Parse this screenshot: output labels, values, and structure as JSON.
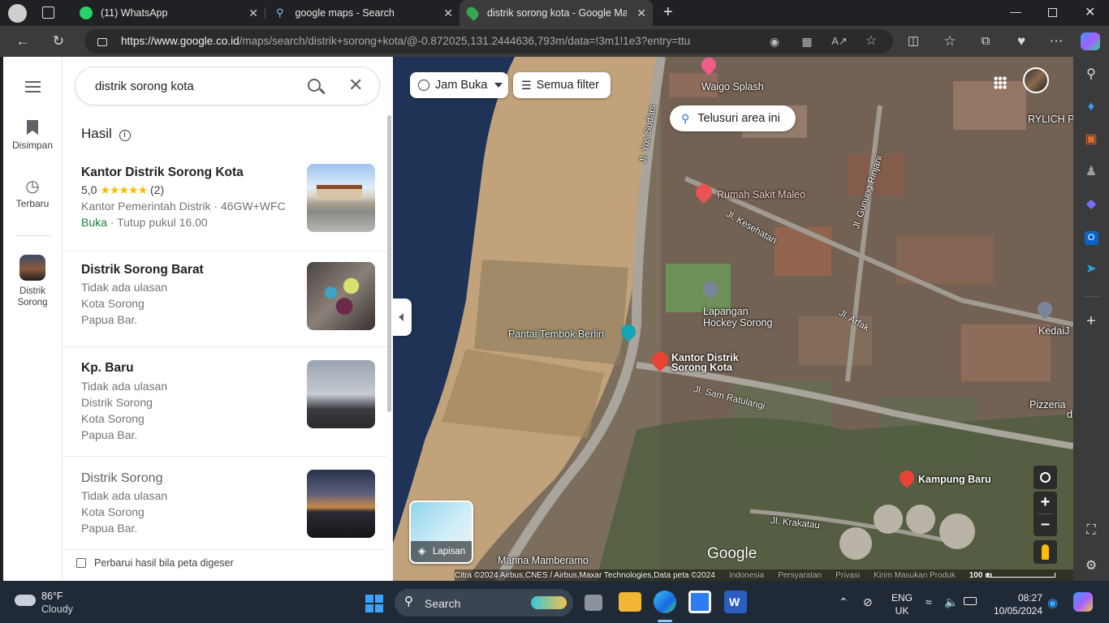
{
  "browser": {
    "tabs": [
      {
        "title": "(11) WhatsApp",
        "icon": "whatsapp-icon"
      },
      {
        "title": "google maps - Search",
        "icon": "search-icon"
      },
      {
        "title": "distrik sorong kota - Google Map",
        "icon": "google-maps-icon"
      }
    ],
    "url_domain": "https://www.google.co.id",
    "url_path": "/maps/search/distrik+sorong+kota/@-0.872025,131.2444636,793m/data=!3m1!1e3?entry=ttu"
  },
  "rail": {
    "menu_label": "",
    "saved_label": "Disimpan",
    "recent_label": "Terbaru",
    "recent_place_label": "Distrik Sorong"
  },
  "panel": {
    "search_value": "distrik sorong kota",
    "results_header": "Hasil",
    "results": [
      {
        "title": "Kantor Distrik Sorong Kota",
        "rating": "5,0",
        "stars": "★★★★★",
        "reviews": "(2)",
        "category": "Kantor Pemerintah Distrik · 46GW+WFC",
        "open": "Buka",
        "hours": " · Tutup pukul 16.00"
      },
      {
        "title": "Distrik Sorong Barat",
        "line1": "Tidak ada ulasan",
        "line2": "Kota Sorong",
        "line3": "Papua Bar."
      },
      {
        "title": "Kp. Baru",
        "line1": "Tidak ada ulasan",
        "line2": "Distrik Sorong",
        "line3": "Kota Sorong",
        "line4": "Papua Bar."
      },
      {
        "title": "Distrik Sorong",
        "line1": "Tidak ada ulasan",
        "line2": "Kota Sorong",
        "line3": "Papua Bar."
      }
    ],
    "update_checkbox": "Perbarui hasil bila peta digeser"
  },
  "map": {
    "open_hours_chip": "Jam Buka",
    "all_filters_chip": "Semua filter",
    "search_area_button": "Telusuri area ini",
    "layers_label": "Lapisan",
    "labels": {
      "waigo": "Waigo Splash",
      "rylich": "RYLICH P",
      "rs_maleo": "Rumah Sakit Maleo",
      "hockey1": "Lapangan",
      "hockey2": "Hockey Sorong",
      "pantai": "Pantai Tembok Berlin",
      "kantor1": "Kantor Distrik",
      "kantor2": "Sorong Kota",
      "kedai": "KedaiJ",
      "pizzeria1": "Pizzeria",
      "pizzeria2": "d",
      "kampung": "Kampung Baru",
      "marina": "Marina Mamberamo"
    },
    "roads": {
      "yos": "Jl. Yos Sudars",
      "rinjani": "Jl. Gunung Rinjani",
      "kesehatan": "Jl. Kesehatan",
      "arfak": "Jl. Arfak",
      "ratulangi": "Jl. Sam Ratulangi",
      "krakatau": "Jl. Krakatau"
    },
    "google_logo": "Google",
    "attribution": "Citra ©2024 Airbus,CNES / Airbus,Maxar Technologies,Data peta ©2024",
    "links": [
      "Indonesia",
      "Persyaratan",
      "Privasi",
      "Kirim Masukan Produk"
    ],
    "scale": "100 m"
  },
  "taskbar": {
    "weather_temp": "86°F",
    "weather_desc": "Cloudy",
    "search_label": "Search",
    "lang1": "ENG",
    "lang2": "UK",
    "time": "08:27",
    "date": "10/05/2024"
  },
  "colors": {
    "maps_red": "#ea4335",
    "star": "#fbbc04",
    "open_green": "#188038",
    "edge_accent": "#3b9cff"
  }
}
